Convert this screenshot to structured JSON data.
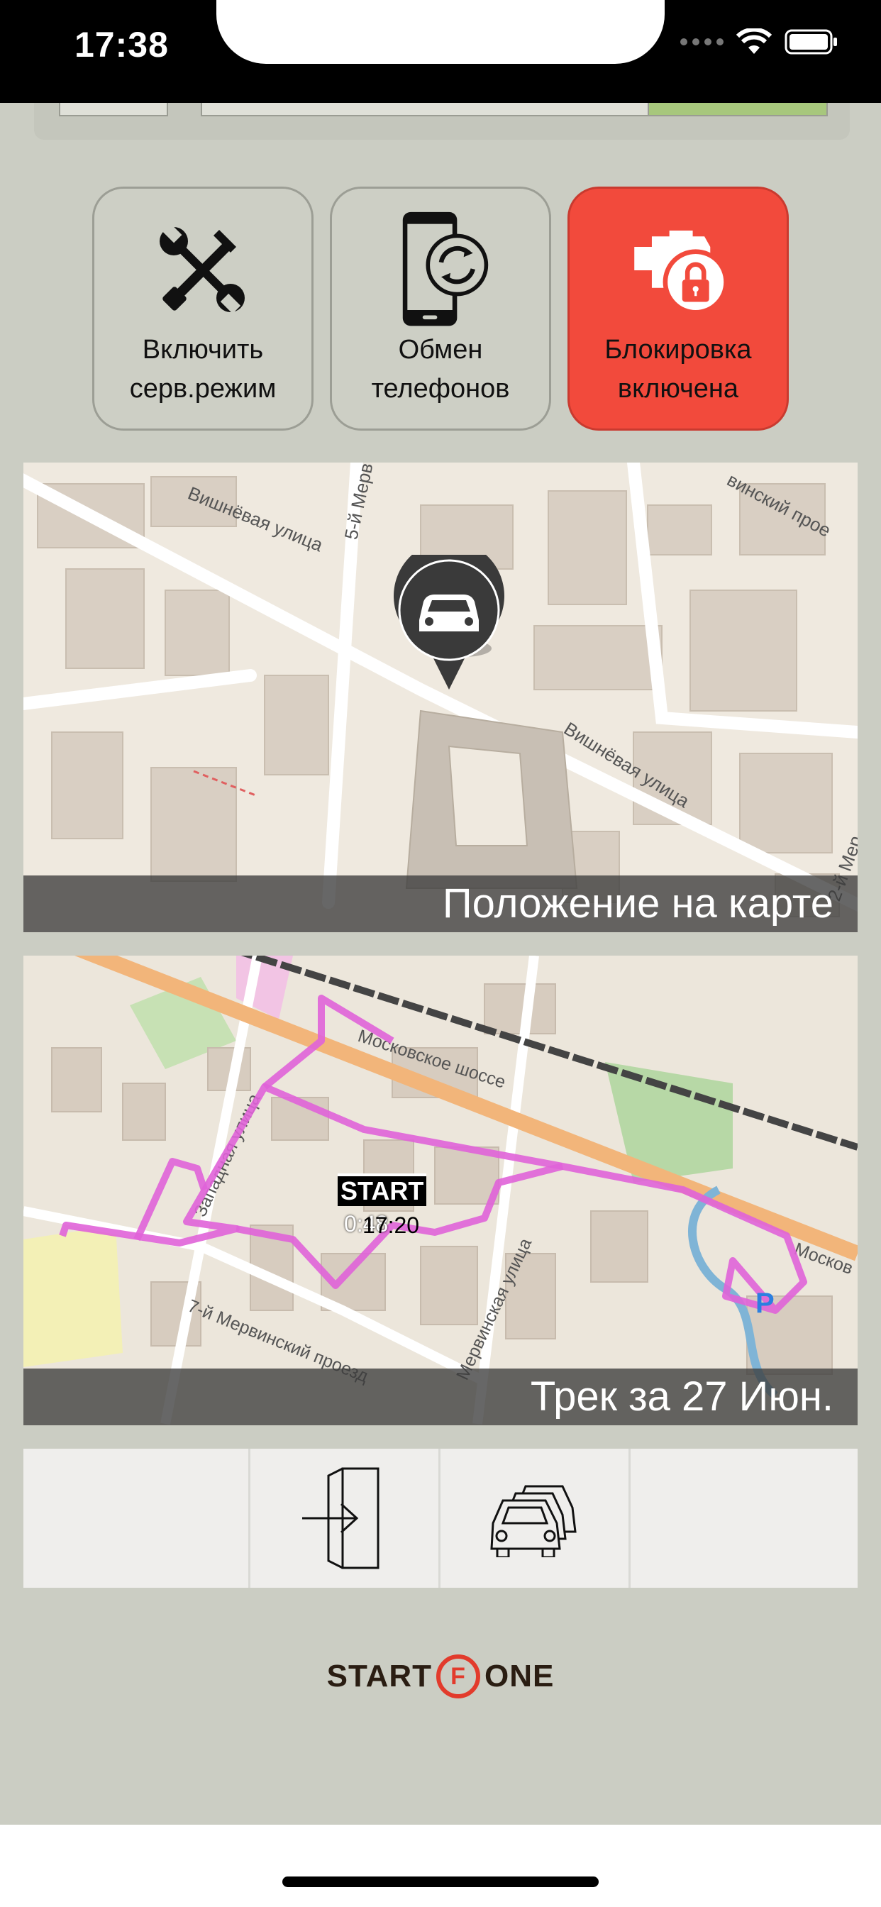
{
  "status_bar": {
    "time": "17:38"
  },
  "actions": [
    {
      "label": "Включить\nсерв.режим",
      "icon": "wrench-screwdriver-icon"
    },
    {
      "label": "Обмен\nтелефонов",
      "icon": "phone-swap-icon"
    },
    {
      "label": "Блокировка\nвключена",
      "icon": "engine-lock-icon",
      "active_color": "#f24a3c"
    }
  ],
  "map_position": {
    "caption": "Положение на карте",
    "street_labels": [
      "Вишнёвая улица",
      "5-й Мерв",
      "Вишнёвая улица",
      "винский прое",
      "2-й Мер"
    ]
  },
  "map_track": {
    "caption": "Трек за 27 Июн.",
    "start_badge": "START",
    "start_time": "17:20",
    "end_time": "0:48",
    "parking_label": "P",
    "street_labels": [
      "Московское шоссе",
      "Западная улица",
      "Мервинская улица",
      "7-й Мервинский проезд",
      "Москов"
    ],
    "track_color": "#e063d8"
  },
  "bottom_nav": {
    "items": [
      "",
      "exit-door-icon",
      "cars-icon",
      ""
    ]
  },
  "logo": {
    "left": "START",
    "middle": "F",
    "right": "ONE"
  }
}
